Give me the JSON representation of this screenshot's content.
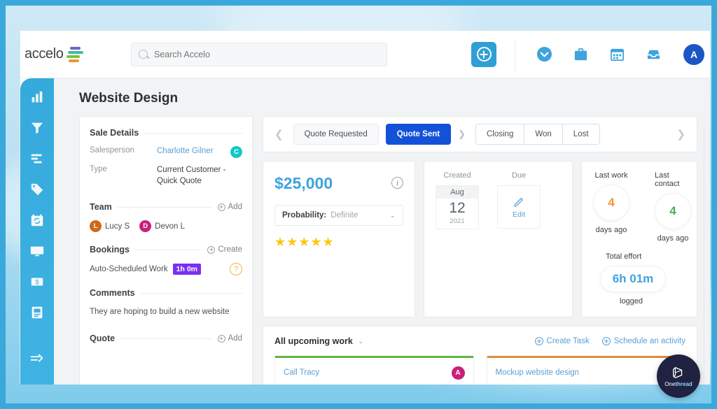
{
  "app": {
    "logo_text": "accelo",
    "logo_mark_colors": [
      "#7b5ec7",
      "#37c0a8",
      "#7cc142",
      "#f0962e"
    ]
  },
  "search": {
    "placeholder": "Search Accelo",
    "value": ""
  },
  "topbar": {
    "add_button": "+",
    "icons": [
      "chevron-circle-icon",
      "briefcase-icon",
      "calendar-icon",
      "inbox-icon"
    ],
    "avatar_initial": "A",
    "avatar_color": "#1a56c4"
  },
  "rail": {
    "items": [
      {
        "icon": "company-bars-icon",
        "label": "Companies"
      },
      {
        "icon": "funnel-icon",
        "label": "Sales"
      },
      {
        "icon": "list-bars-icon",
        "label": "Projects"
      },
      {
        "icon": "tag-icon",
        "label": "Tickets"
      },
      {
        "icon": "retainer-calendar-icon",
        "label": "Retainers"
      },
      {
        "icon": "monitor-icon",
        "label": "Timesheets"
      },
      {
        "icon": "billing-icon",
        "label": "Billing"
      },
      {
        "icon": "reports-book-icon",
        "label": "Reports"
      },
      {
        "icon": "collapse-arrow-icon",
        "label": "Collapse"
      }
    ]
  },
  "page": {
    "title": "Website Design"
  },
  "sale_details": {
    "heading": "Sale Details",
    "fields": [
      {
        "label": "Salesperson",
        "value": "Charlotte Gilner",
        "is_link": true,
        "avatar_initial": "C",
        "avatar_color": "#14c7c7"
      },
      {
        "label": "Type",
        "value": "Current Customer - Quick Quote",
        "is_link": false
      }
    ],
    "team": {
      "heading": "Team",
      "action": "Add",
      "members": [
        {
          "name": "Lucy S",
          "initial": "L",
          "color": "#cb6a1e"
        },
        {
          "name": "Devon L",
          "initial": "D",
          "color": "#c9207a"
        }
      ]
    },
    "bookings": {
      "heading": "Bookings",
      "action": "Create",
      "auto_scheduled_label": "Auto-Scheduled Work",
      "auto_scheduled_value": "1h 0m",
      "auto_scheduled_color": "#7b2ff2",
      "help_glyph": "?"
    },
    "comments": {
      "heading": "Comments",
      "text": "They are hoping to build a new website"
    },
    "quote": {
      "heading": "Quote",
      "action": "Add"
    }
  },
  "status_strip": {
    "prev_arrow": "❮",
    "next_arrow": "❯",
    "separator": "❯",
    "pills": [
      {
        "label": "Quote Requested",
        "active": false
      },
      {
        "label": "Quote Sent",
        "active": true
      }
    ],
    "group": [
      "Closing",
      "Won",
      "Lost"
    ],
    "active_color": "#1352d8"
  },
  "value_card": {
    "amount": "$25,000",
    "amount_color": "#3fa3dd",
    "info_glyph": "i",
    "probability_label": "Probability:",
    "probability_value": "Definite",
    "caret": "⌄",
    "stars": "★★★★★",
    "star_color": "#fac712",
    "star_count": 5
  },
  "date_card": {
    "created": {
      "caption": "Created",
      "month": "Aug",
      "day": "12",
      "year": "2021"
    },
    "due": {
      "caption": "Due",
      "action": "Edit",
      "icon": "pencil-icon"
    }
  },
  "effort_card": {
    "metrics": [
      {
        "caption": "Last work",
        "value": "4",
        "sub": "days ago",
        "color": "#f0962e"
      },
      {
        "caption": "Last contact",
        "value": "4",
        "sub": "days ago",
        "color": "#4caf50"
      }
    ],
    "total_effort_label": "Total effort",
    "total_effort_value": "6h 01m",
    "total_effort_color": "#3fa3dd",
    "total_effort_sub": "logged"
  },
  "upcoming_work": {
    "title": "All upcoming work",
    "caret": "⌄",
    "actions": [
      {
        "label": "Create Task",
        "icon": "plus-circle-icon"
      },
      {
        "label": "Schedule an activity",
        "icon": "plus-circle-icon"
      }
    ],
    "items": [
      {
        "name": "Call Tracy",
        "accent": "#5fb544",
        "avatar_initial": "A",
        "avatar_color": "#c9207a",
        "has_avatar": true
      },
      {
        "name": "Mockup website design",
        "accent": "#e08b3c",
        "has_avatar": false
      }
    ]
  },
  "watermark": {
    "text_a": "One",
    "text_b": "thread",
    "icon": "onethread-logo-icon"
  }
}
